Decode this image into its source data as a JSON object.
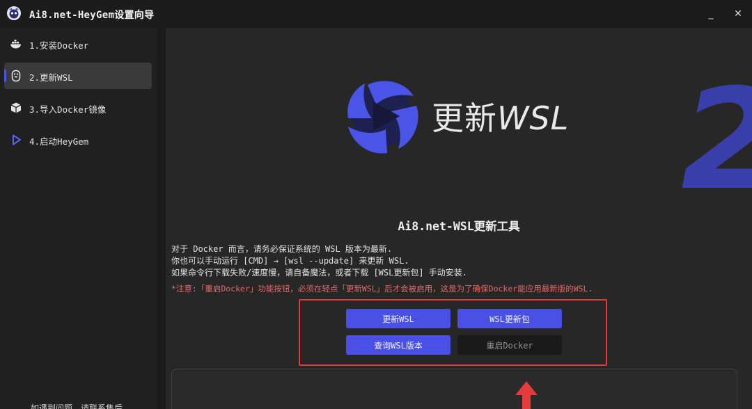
{
  "window": {
    "title": "Ai8.net-HeyGem设置向导",
    "minimize": "_",
    "close": "✕"
  },
  "sidebar": {
    "items": [
      {
        "label": "1.安装Docker",
        "icon": "docker-icon",
        "active": false
      },
      {
        "label": "2.更新WSL",
        "icon": "linux-penguin-icon",
        "active": true
      },
      {
        "label": "3.导入Docker镜像",
        "icon": "cube-icon",
        "active": false
      },
      {
        "label": "4.启动HeyGem",
        "icon": "play-icon",
        "active": false
      }
    ],
    "footer": "如遇到问题，请联系售后"
  },
  "hero": {
    "title_cn": "更新",
    "title_en": "WSL",
    "step_number": "2"
  },
  "main": {
    "tool_title": "Ai8.net-WSL更新工具",
    "desc_line1": "对于 Docker 而言，请务必保证系统的 WSL 版本为最新.",
    "desc_line2": "你也可以手动运行 [CMD] → [wsl --update] 来更新 WSL.",
    "desc_line3": "如果命令行下载失败/速度慢，请自备魔法，或者下载 [WSL更新包] 手动安装.",
    "warning": "*注意:「重启Docker」功能按钮，必须在轻点「更新WSL」后才会被启用，这是为了确保Docker能应用最新版的WSL."
  },
  "buttons": {
    "update_wsl": "更新WSL",
    "wsl_package": "WSL更新包",
    "query_version": "查询WSL版本",
    "restart_docker": "重启Docker"
  },
  "colors": {
    "accent": "#4a4fe6",
    "warning": "#e06a6a",
    "highlight": "#e53b3b",
    "step_number": "#3a41b2"
  }
}
